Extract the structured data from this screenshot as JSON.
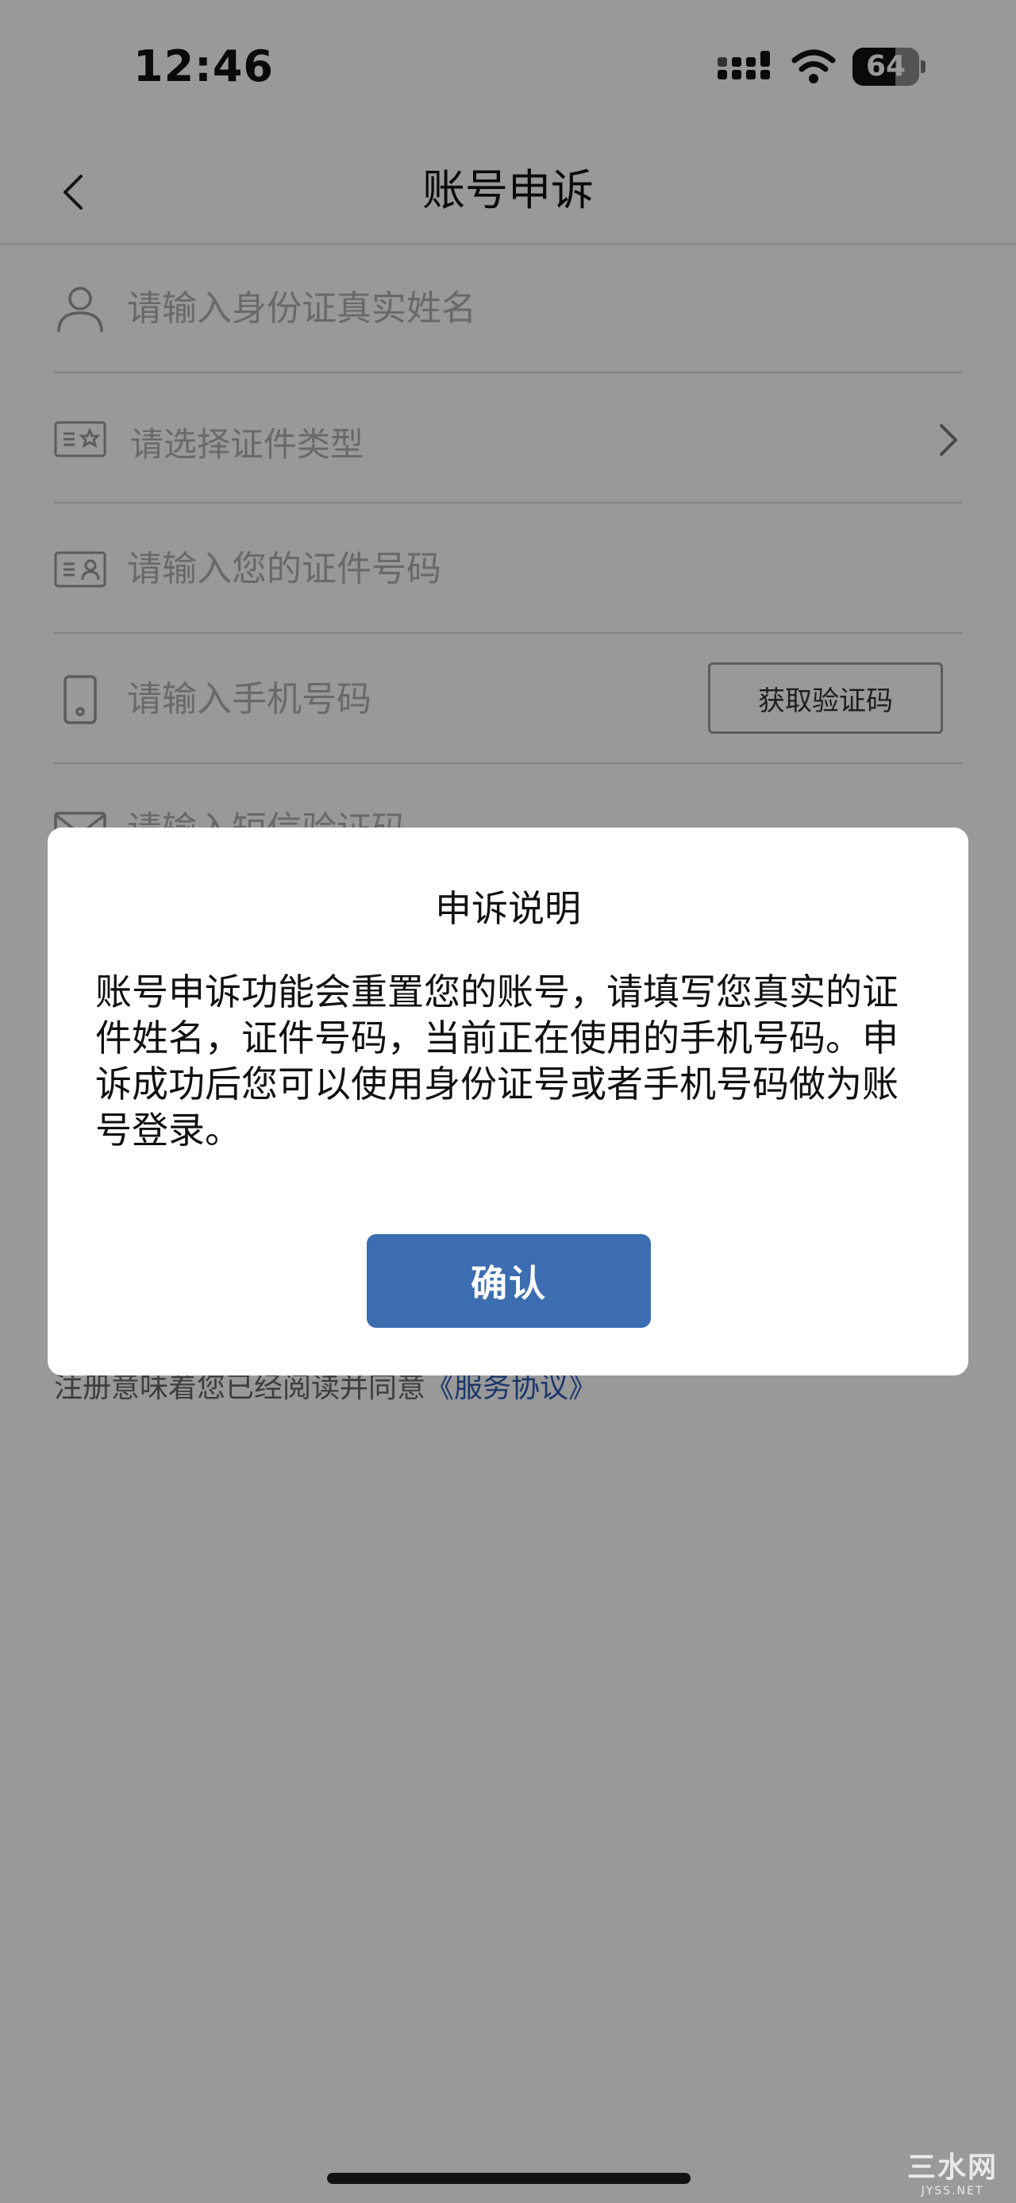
{
  "status_bar": {
    "time": "12:46",
    "battery": "64",
    "battery_level": 0.64
  },
  "nav": {
    "title": "账号申诉"
  },
  "form": {
    "name_placeholder": "请输入身份证真实姓名",
    "id_type_placeholder": "请选择证件类型",
    "id_number_placeholder": "请输入您的证件号码",
    "phone_placeholder": "请输入手机号码",
    "get_code_label": "获取验证码",
    "sms_placeholder": "请输入短信验证码"
  },
  "agreement": {
    "text": "注册意味着您已经阅读并同意",
    "link": "《服务协议》"
  },
  "dialog": {
    "title": "申诉说明",
    "body": "账号申诉功能会重置您的账号，请填写您真实的证件姓名，证件号码，当前正在使用的手机号码。申诉成功后您可以使用身份证号或者手机号码做为账号登录。",
    "confirm_label": "确认"
  },
  "watermark": {
    "main": "三水网",
    "sub": "JYSS.NET"
  },
  "colors": {
    "accent": "#3c6db0",
    "link": "#2d5bb5",
    "overlay": "rgba(0,0,0,0.4)"
  }
}
